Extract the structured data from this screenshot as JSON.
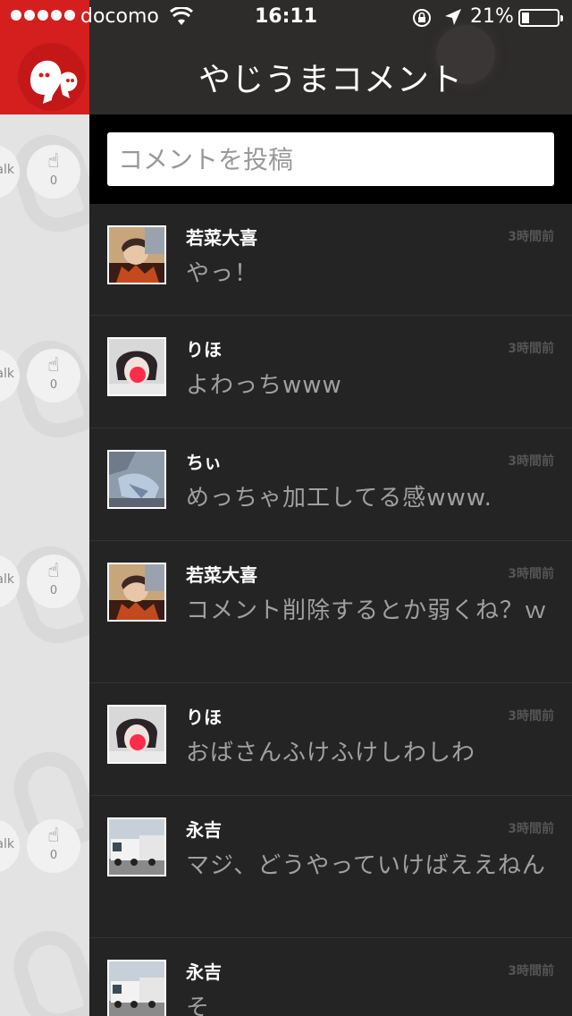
{
  "status": {
    "carrier": "docomo",
    "time": "16:11",
    "battery": "21%",
    "battery_level": 0.21
  },
  "header": {
    "title": "やじうまコメント"
  },
  "input": {
    "placeholder": "コメントを投稿"
  },
  "sidebar": {
    "talk_label": "alk",
    "clap_counts": [
      "0",
      "0",
      "0",
      "0"
    ]
  },
  "comments": [
    {
      "user": "若菜大喜",
      "time": "3時間前",
      "text": "やっ！",
      "avatar": "selfie-boy"
    },
    {
      "user": "りほ",
      "time": "3時間前",
      "text": "よわっちwww",
      "avatar": "selfie-girl"
    },
    {
      "user": "ちぃ",
      "time": "3時間前",
      "text": "めっちゃ加工してる感www.",
      "avatar": "blue-fabric"
    },
    {
      "user": "若菜大喜",
      "time": "3時間前",
      "text": "コメント削除するとか弱くね？ｗ",
      "avatar": "selfie-boy"
    },
    {
      "user": "りほ",
      "time": "3時間前",
      "text": "おばさんふけふけしわしわ",
      "avatar": "selfie-girl"
    },
    {
      "user": "永吉",
      "time": "3時間前",
      "text": "マジ、どうやっていけばええねん",
      "avatar": "trucks"
    },
    {
      "user": "永吉",
      "time": "3時間前",
      "text": "そ",
      "avatar": "trucks"
    }
  ],
  "colors": {
    "brand_red": "#d51f1f",
    "panel_bg": "#242424",
    "nav_bg": "#2e2b2b"
  }
}
